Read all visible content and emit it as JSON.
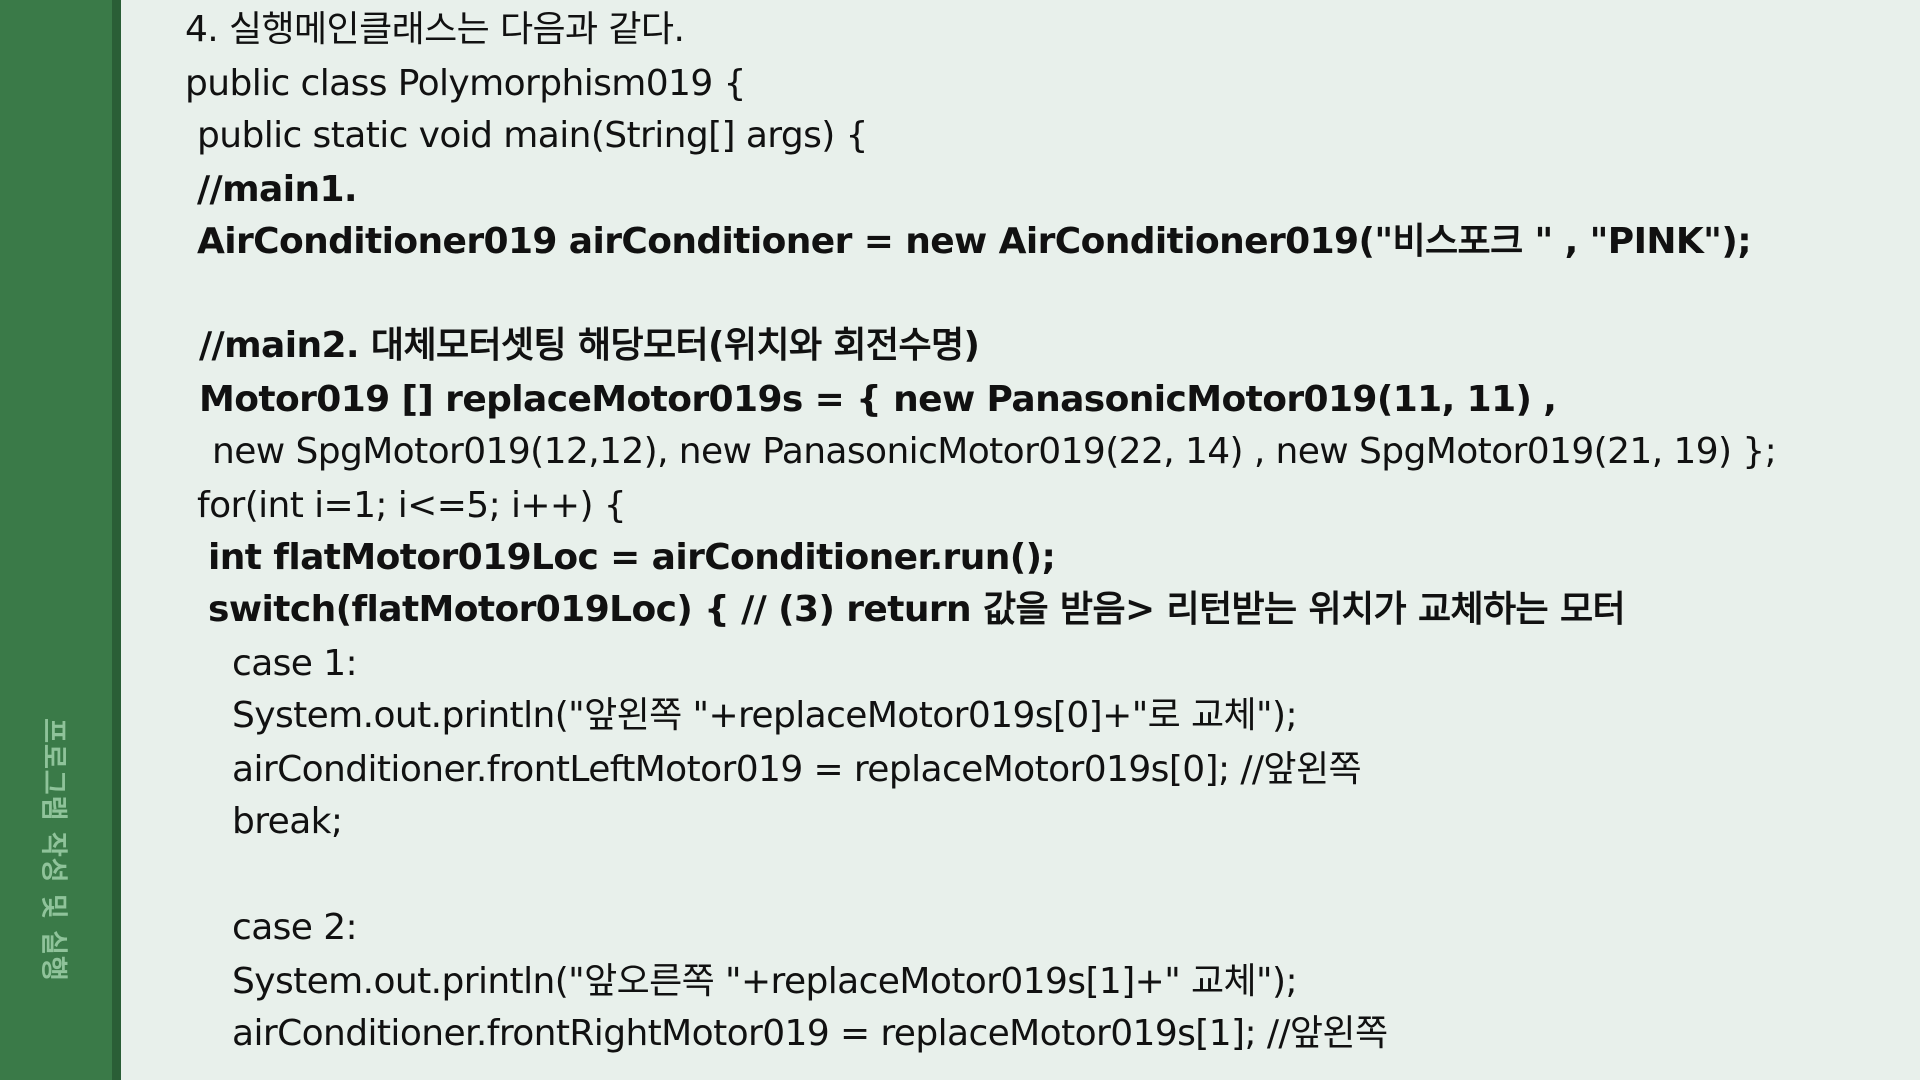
{
  "sidebar": {
    "label": "프로그램 작성 및 실행"
  },
  "code_lines": [
    "4. 실행메인클래스는 다음과 같다.",
    "public class Polymorphism019 {",
    "public static void main(String[] args) {",
    "//main1.",
    "AirConditioner019 airConditioner = new AirConditioner019(\"비스포크 \" , \"PINK\");",
    "//main2. 대체모터셋팅 해당모터(위치와 회전수명)",
    "Motor019 [] replaceMotor019s = { new PanasonicMotor019(11, 11) ,",
    "new SpgMotor019(12,12), new PanasonicMotor019(22, 14) , new SpgMotor019(21, 19) };",
    "for(int i=1; i<=5; i++) {",
    "int flatMotor019Loc = airConditioner.run();",
    "switch(flatMotor019Loc) { // (3) return 값을 받음> 리턴받는 위치가 교체하는 모터",
    "case 1:",
    "System.out.println(\"앞왼쪽 \"+replaceMotor019s[0]+\"로 교체\");",
    "airConditioner.frontLeftMotor019 = replaceMotor019s[0]; //앞왼쪽",
    "break;",
    "case 2:",
    "System.out.println(\"앞오른쪽 \"+replaceMotor019s[1]+\" 교체\");",
    "airConditioner.frontRightMotor019 = replaceMotor019s[1]; //앞왼쪽"
  ]
}
